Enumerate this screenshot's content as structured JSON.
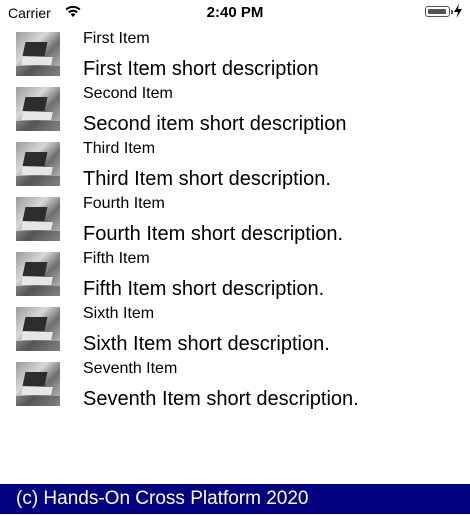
{
  "status_bar": {
    "carrier": "Carrier",
    "time": "2:40 PM",
    "icons": [
      "wifi-icon",
      "battery-icon",
      "charging-bolt-icon"
    ]
  },
  "items": [
    {
      "title": "First Item",
      "description": "First Item short description"
    },
    {
      "title": "Second Item",
      "description": "Second item short description"
    },
    {
      "title": "Third Item",
      "description": "Third Item short description."
    },
    {
      "title": "Fourth Item",
      "description": "Fourth Item short description."
    },
    {
      "title": "Fifth Item",
      "description": "Fifth Item short description."
    },
    {
      "title": "Sixth Item",
      "description": "Sixth Item short description."
    },
    {
      "title": "Seventh Item",
      "description": "Seventh Item short description."
    }
  ],
  "footer": {
    "text": "(c) Hands-On Cross Platform 2020",
    "background": "#000080"
  }
}
